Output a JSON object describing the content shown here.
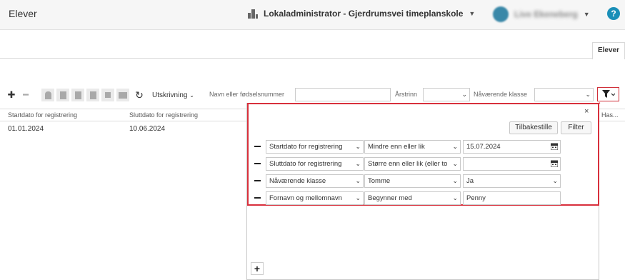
{
  "header": {
    "title": "Elever",
    "school": "Lokaladministrator - Gjerdrumsvei timeplanskole",
    "user": "Live Ekeneberg",
    "help": "?"
  },
  "tabs": {
    "active": "Elever"
  },
  "toolbar": {
    "print_label": "Utskrivning",
    "search_label": "Navn eller fødselsnummer",
    "search_value": "",
    "year_label": "Årstrinn",
    "year_value": "",
    "class_label": "Nåværende klasse",
    "class_value": ""
  },
  "grid": {
    "columns": [
      "Startdato for registrering",
      "Sluttdato for registrering",
      "Has..."
    ],
    "rows": [
      {
        "start": "01.01.2024",
        "end": "10.06.2024"
      }
    ]
  },
  "filter_panel": {
    "reset_label": "Tilbakestille",
    "filter_label": "Filter",
    "close": "×",
    "rows": [
      {
        "field": "Startdato for registrering",
        "operator": "Mindre enn eller lik",
        "value": "15.07.2024",
        "value_type": "date"
      },
      {
        "field": "Sluttdato for registrering",
        "operator": "Større enn eller lik (eller to",
        "value": "",
        "value_type": "date"
      },
      {
        "field": "Nåværende klasse",
        "operator": "Tomme",
        "value": "Ja",
        "value_type": "select"
      },
      {
        "field": "Fornavn og mellomnavn",
        "operator": "Begynner med",
        "value": "Penny",
        "value_type": "text"
      }
    ],
    "add_label": "+"
  },
  "colors": {
    "accent": "#1a8fb8",
    "highlight": "#d8303c"
  }
}
